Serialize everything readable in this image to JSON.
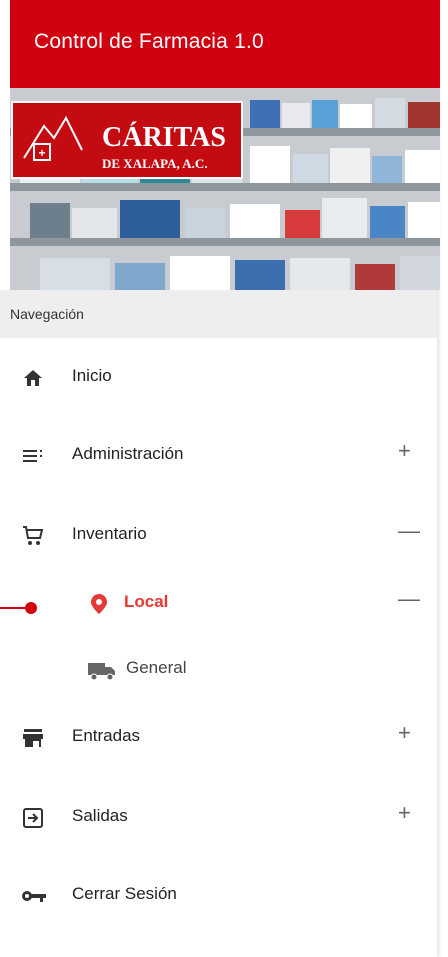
{
  "header": {
    "title": "Control de Farmacia 1.0"
  },
  "logo": {
    "name": "CÁRITAS",
    "subtitle": "DE XALAPA, A.C."
  },
  "nav": {
    "heading": "Navegación",
    "items": [
      {
        "label": "Inicio",
        "icon": "home-icon"
      },
      {
        "label": "Administración",
        "icon": "list-icon",
        "toggle": "+"
      },
      {
        "label": "Inventario",
        "icon": "cart-icon",
        "toggle": "—"
      },
      {
        "label": "Local",
        "icon": "location-pin-icon",
        "toggle": "—"
      },
      {
        "label": "General",
        "icon": "truck-icon"
      },
      {
        "label": "Entradas",
        "icon": "store-icon",
        "toggle": "+"
      },
      {
        "label": "Salidas",
        "icon": "exit-icon",
        "toggle": "+"
      },
      {
        "label": "Cerrar Sesión",
        "icon": "key-icon"
      }
    ]
  },
  "colors": {
    "brand": "#d10010",
    "active": "#e53935",
    "nav_header_bg": "#eeeeee"
  }
}
